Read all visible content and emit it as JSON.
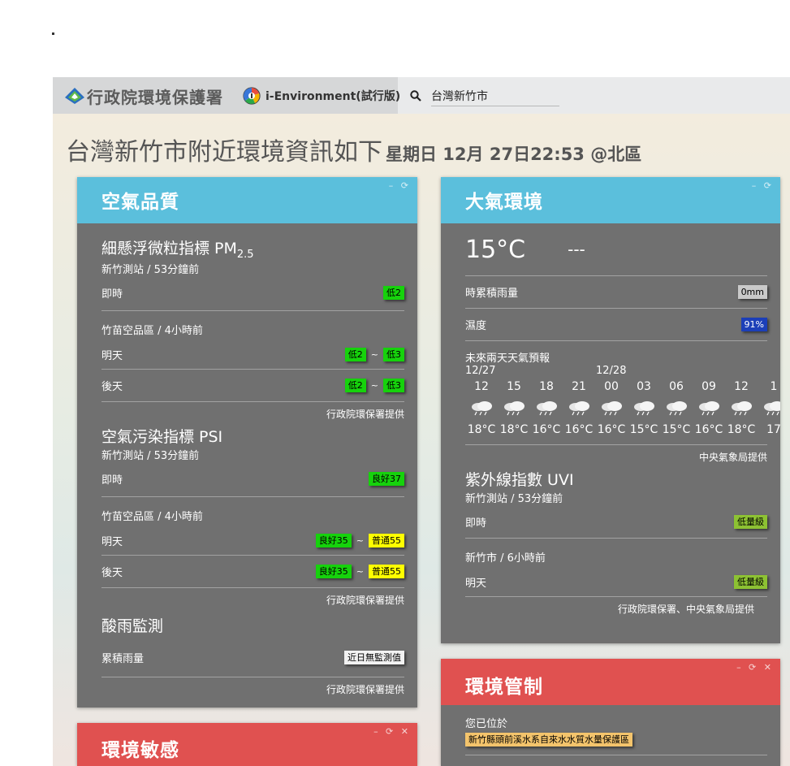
{
  "header": {
    "brand": "行政院環境保護署",
    "app_name": "i-Environment(試行版)",
    "search_value": "台灣新竹市"
  },
  "headline": {
    "main": "台灣新竹市附近環境資訊如下",
    "sub": "星期日 12月 27日22:53 @北區"
  },
  "air": {
    "title": "空氣品質",
    "pm_title": "細懸浮微粒指標 PM",
    "pm_subscript": "2.5",
    "pm_station": "新竹測站 / 53分鐘前",
    "pm_now_label": "即時",
    "pm_now_value": "低2",
    "pm_forecast_area": "竹苗空品區 / 4小時前",
    "pm_tomorrow_label": "明天",
    "pm_tomorrow_from": "低2",
    "pm_tomorrow_to": "低3",
    "pm_after_label": "後天",
    "pm_after_from": "低2",
    "pm_after_to": "低3",
    "tilde": "~",
    "credit": "行政院環保署提供",
    "psi_title": "空氣污染指標 PSI",
    "psi_station": "新竹測站 / 53分鐘前",
    "psi_now_label": "即時",
    "psi_now_value": "良好37",
    "psi_forecast_area": "竹苗空品區 / 4小時前",
    "psi_tomorrow_label": "明天",
    "psi_tomorrow_from": "良好35",
    "psi_tomorrow_to": "普通55",
    "psi_after_label": "後天",
    "psi_after_from": "良好35",
    "psi_after_to": "普通55",
    "acid_title": "酸雨監測",
    "acid_label": "累積雨量",
    "acid_value": "近日無監測值"
  },
  "weather": {
    "title": "大氣環境",
    "temperature": "15°C",
    "condition": "---",
    "rain_label": "時累積雨量",
    "rain_value": "0mm",
    "humidity_label": "濕度",
    "humidity_value": "91%",
    "forecast_label": "未來兩天天氣預報",
    "date1": "12/27",
    "date2": "12/28",
    "hours": [
      "12",
      "15",
      "18",
      "21",
      "00",
      "03",
      "06",
      "09",
      "12",
      "1"
    ],
    "temps": [
      "18°C",
      "18°C",
      "16°C",
      "16°C",
      "16°C",
      "15°C",
      "15°C",
      "16°C",
      "18°C",
      "17"
    ],
    "forecast_credit": "中央氣象局提供",
    "uvi_title": "紫外線指數 UVI",
    "uvi_station": "新竹測站 / 53分鐘前",
    "uvi_now_label": "即時",
    "uvi_now_value": "低量級",
    "uvi_city": "新竹市 / 6小時前",
    "uvi_tomorrow_label": "明天",
    "uvi_tomorrow_value": "低量級",
    "uvi_credit": "行政院環保署、中央氣象局提供"
  },
  "control": {
    "title": "環境管制",
    "located_label": "您已位於",
    "zone": "新竹縣頭前溪水系自來水水質水量保護區"
  },
  "sensitive": {
    "title": "環境敏感"
  },
  "colors": {
    "panel_blue": "#5bbfdc",
    "panel_red": "#e05150",
    "panel_body": "#707070",
    "badge_green": "#16d20c",
    "badge_yellow": "#ffff00",
    "badge_blue": "#1c3fb8",
    "badge_lime": "#8dc233"
  }
}
